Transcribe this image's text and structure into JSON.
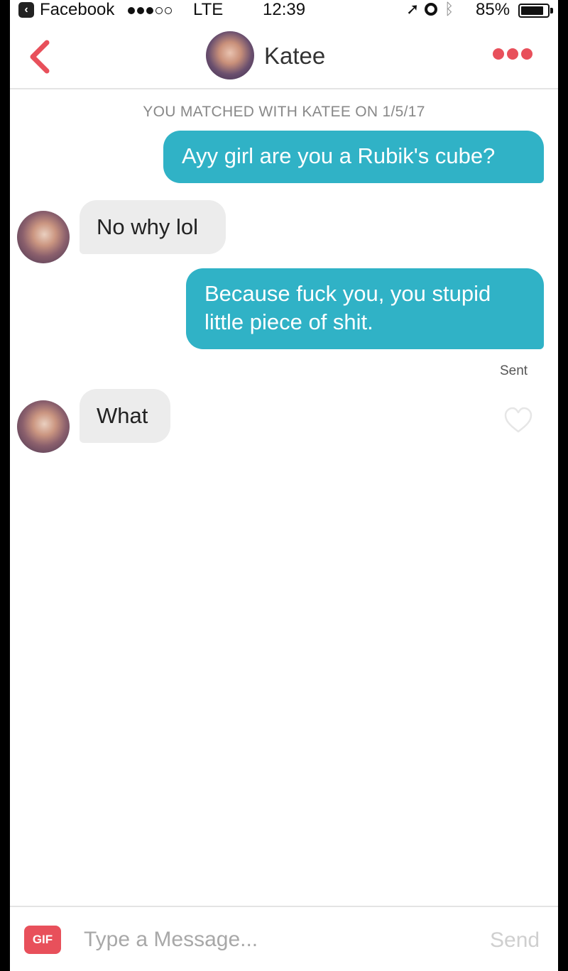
{
  "status_bar": {
    "app_back_label": "Facebook",
    "signal_strength": "3 of 5",
    "network": "LTE",
    "time": "12:39",
    "battery_percent": "85%",
    "battery_level": 0.85
  },
  "header": {
    "contact_name": "Katee",
    "back_icon": "chevron-left-icon",
    "more_icon": "three-dots-icon",
    "accent_color": "#e8505b"
  },
  "chat": {
    "match_banner": "YOU MATCHED WITH KATEE ON 1/5/17",
    "messages": [
      {
        "direction": "outgoing",
        "text": "Ayy girl are you a Rubik's cube?"
      },
      {
        "direction": "incoming",
        "text": "No why lol"
      },
      {
        "direction": "outgoing",
        "text": "Because fuck you, you stupid little piece of shit."
      },
      {
        "direction": "incoming",
        "text": "What"
      }
    ],
    "sent_status": "Sent",
    "outgoing_color": "#30b2c6",
    "incoming_color": "#ececec"
  },
  "composer": {
    "gif_label": "GIF",
    "placeholder": "Type a Message...",
    "value": "",
    "send_label": "Send"
  }
}
